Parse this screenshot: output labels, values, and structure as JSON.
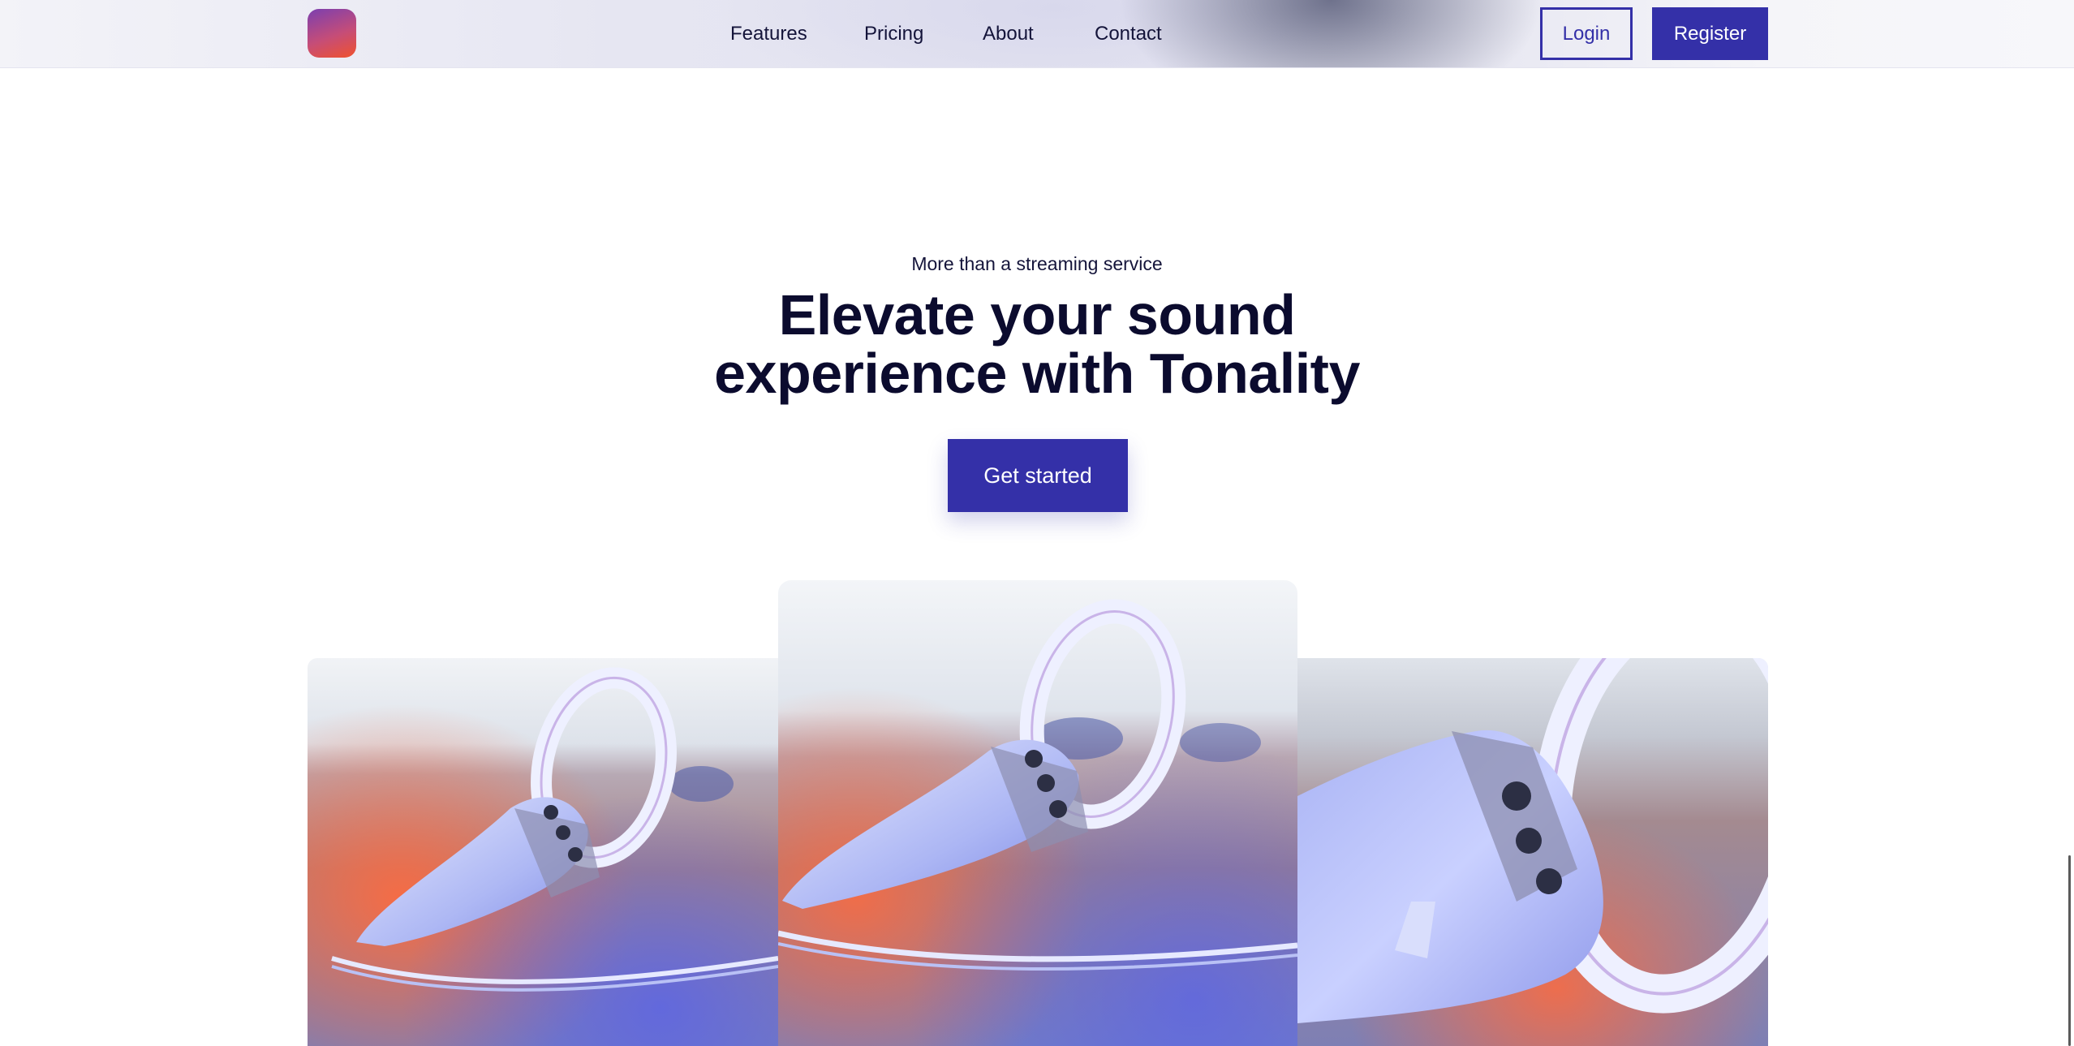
{
  "header": {
    "nav": [
      {
        "label": "Features"
      },
      {
        "label": "Pricing"
      },
      {
        "label": "About"
      },
      {
        "label": "Contact"
      }
    ],
    "login_label": "Login",
    "register_label": "Register"
  },
  "hero": {
    "eyebrow": "More than a streaming service",
    "title_line1": "Elevate your sound",
    "title_line2": "experience with Tonality",
    "cta_label": "Get started"
  },
  "colors": {
    "accent": "#3430a8",
    "text": "#0b0b2e",
    "logo_gradient": [
      "#7b3fb0",
      "#f0522e"
    ]
  },
  "gallery": {
    "photo_subject": "vr-controller-photo"
  }
}
